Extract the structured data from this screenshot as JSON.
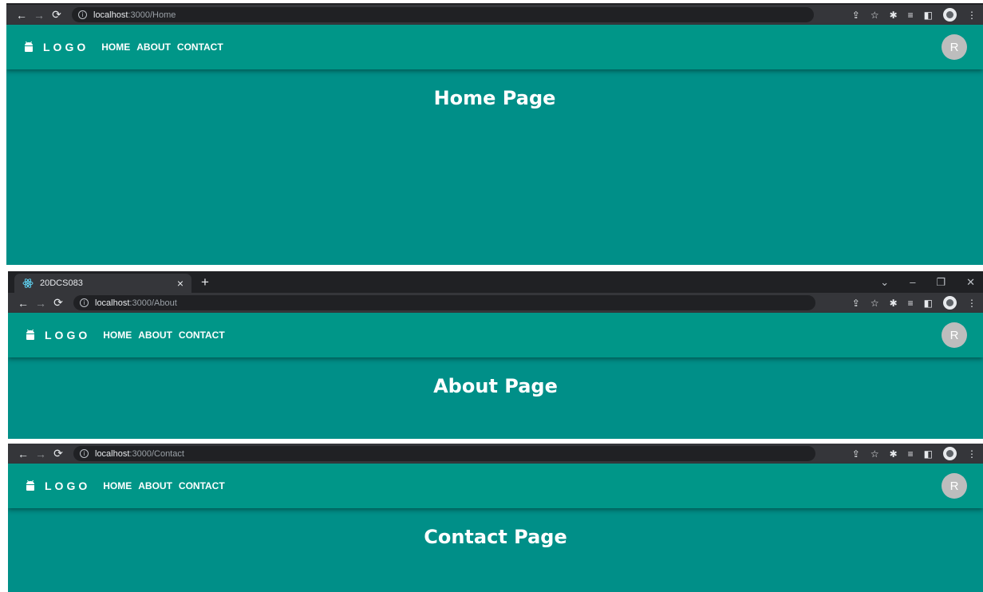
{
  "browser": {
    "tab_title": "20DCS083",
    "new_tab_symbol": "+",
    "tab_close_symbol": "×",
    "win_controls": {
      "dropdown": "⌄",
      "minimize": "–",
      "restore": "❐",
      "close": "✕"
    }
  },
  "windows": [
    {
      "url_host": "localhost",
      "url_path": ":3000/Home",
      "page_heading": "Home Page"
    },
    {
      "url_host": "localhost",
      "url_path": ":3000/About",
      "page_heading": "About Page"
    },
    {
      "url_host": "localhost",
      "url_path": ":3000/Contact",
      "page_heading": "Contact Page"
    }
  ],
  "appbar": {
    "logo_text": "LOGO",
    "nav": [
      "HOME",
      "ABOUT",
      "CONTACT"
    ],
    "avatar_letter": "R"
  },
  "colors": {
    "appbar": "#009688",
    "content": "#008f88",
    "avatar": "#bdbdbd",
    "chrome_dark": "#202124",
    "chrome_toolbar": "#35363a"
  },
  "icons": [
    "back-arrow-icon",
    "forward-arrow-icon",
    "reload-icon",
    "info-icon",
    "share-icon",
    "star-icon",
    "extensions-icon",
    "reading-list-icon",
    "side-panel-icon",
    "profile-icon",
    "menu-dots-icon",
    "android-logo-icon",
    "react-favicon-icon"
  ]
}
